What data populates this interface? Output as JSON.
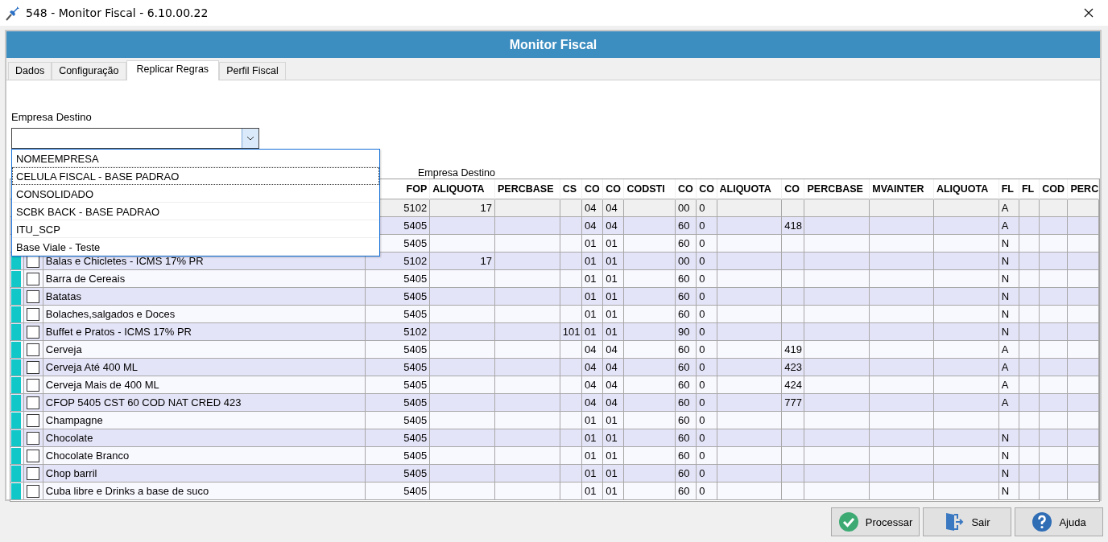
{
  "window": {
    "title": "548 - Monitor Fiscal - 6.10.00.22"
  },
  "header": {
    "title": "Monitor Fiscal"
  },
  "tabs": [
    {
      "label": "Dados",
      "selected": false
    },
    {
      "label": "Configuração",
      "selected": false
    },
    {
      "label": "Replicar Regras",
      "selected": true
    },
    {
      "label": "Perfil Fiscal",
      "selected": false
    }
  ],
  "empresa_destino": {
    "label": "Empresa Destino",
    "expanded": true,
    "options": [
      {
        "label": "NOMEEMPRESA",
        "focused": false
      },
      {
        "label": "CELULA FISCAL - BASE PADRAO",
        "focused": true
      },
      {
        "label": "CONSOLIDADO",
        "focused": false
      },
      {
        "label": "SCBK BACK - BASE PADRAO",
        "focused": false
      },
      {
        "label": "ITU_SCP",
        "focused": false
      },
      {
        "label": "Base Viale - Teste",
        "focused": false
      }
    ]
  },
  "grid": {
    "caption": "Empresa Destino",
    "columns": [
      "FOP",
      "ALIQUOTA",
      "PERCBASE",
      "CS",
      "CO",
      "CO",
      "CODSTI",
      "CO",
      "CO",
      "ALIQUOTA",
      "CO",
      "PERCBASE",
      "MVAINTER",
      "ALIQUOTA",
      "FL",
      "FL",
      "COD",
      "PERC"
    ],
    "rows": [
      {
        "selected": true,
        "cells": [
          "5102",
          "17",
          null,
          null,
          "04",
          "04",
          null,
          "00",
          "0",
          null,
          null,
          null,
          null,
          null,
          "A",
          null,
          null,
          null
        ]
      },
      {
        "selected": false,
        "cells": [
          "5405",
          null,
          null,
          null,
          "04",
          "04",
          null,
          "60",
          "0",
          null,
          "418",
          null,
          null,
          null,
          "A",
          null,
          null,
          null
        ]
      },
      {
        "selected": false,
        "cells": [
          "5405",
          null,
          null,
          null,
          "01",
          "01",
          null,
          "60",
          "0",
          null,
          null,
          null,
          null,
          null,
          "N",
          null,
          null,
          null
        ]
      },
      {
        "selected": false,
        "name": "Balas e Chicletes - ICMS 17% PR",
        "cells": [
          "5102",
          "17",
          null,
          null,
          "01",
          "01",
          null,
          "00",
          "0",
          null,
          null,
          null,
          null,
          null,
          "N",
          null,
          null,
          null
        ]
      },
      {
        "selected": false,
        "checked": false,
        "name": "Barra de Cereais",
        "cells": [
          "5405",
          null,
          null,
          null,
          "01",
          "01",
          null,
          "60",
          "0",
          null,
          null,
          null,
          null,
          null,
          "N",
          null,
          null,
          null
        ]
      },
      {
        "selected": false,
        "checked": false,
        "name": "Batatas",
        "cells": [
          "5405",
          null,
          null,
          null,
          "01",
          "01",
          null,
          "60",
          "0",
          null,
          null,
          null,
          null,
          null,
          "N",
          null,
          null,
          null
        ]
      },
      {
        "selected": false,
        "checked": false,
        "name": "Bolaches,salgados e Doces",
        "cells": [
          "5405",
          null,
          null,
          null,
          "01",
          "01",
          null,
          "60",
          "0",
          null,
          null,
          null,
          null,
          null,
          "N",
          null,
          null,
          null
        ]
      },
      {
        "selected": false,
        "checked": false,
        "name": "Buffet e Pratos - ICMS 17% PR",
        "cells": [
          "5102",
          null,
          null,
          "101",
          "01",
          "01",
          null,
          "90",
          "0",
          null,
          null,
          null,
          null,
          null,
          "N",
          null,
          null,
          null
        ]
      },
      {
        "selected": false,
        "checked": false,
        "name": "Cerveja",
        "cells": [
          "5405",
          null,
          null,
          null,
          "04",
          "04",
          null,
          "60",
          "0",
          null,
          "419",
          null,
          null,
          null,
          "A",
          null,
          null,
          null
        ]
      },
      {
        "selected": false,
        "checked": false,
        "name": "Cerveja Até 400 ML",
        "cells": [
          "5405",
          null,
          null,
          null,
          "04",
          "04",
          null,
          "60",
          "0",
          null,
          "423",
          null,
          null,
          null,
          "A",
          null,
          null,
          null
        ]
      },
      {
        "selected": false,
        "checked": false,
        "name": "Cerveja Mais de 400 ML",
        "cells": [
          "5405",
          null,
          null,
          null,
          "04",
          "04",
          null,
          "60",
          "0",
          null,
          "424",
          null,
          null,
          null,
          "A",
          null,
          null,
          null
        ]
      },
      {
        "selected": false,
        "checked": false,
        "name": "CFOP 5405 CST 60 COD NAT CRED 423",
        "cells": [
          "5405",
          null,
          null,
          null,
          "04",
          "04",
          null,
          "60",
          "0",
          null,
          "777",
          null,
          null,
          null,
          "A",
          null,
          null,
          null
        ]
      },
      {
        "selected": false,
        "checked": false,
        "name": "Champagne",
        "cells": [
          "5405",
          null,
          null,
          null,
          "01",
          "01",
          null,
          "60",
          "0",
          null,
          null,
          null,
          null,
          null,
          null,
          null,
          null,
          null
        ]
      },
      {
        "selected": false,
        "checked": false,
        "name": "Chocolate",
        "cells": [
          "5405",
          null,
          null,
          null,
          "01",
          "01",
          null,
          "60",
          "0",
          null,
          null,
          null,
          null,
          null,
          "N",
          null,
          null,
          null
        ]
      },
      {
        "selected": false,
        "checked": false,
        "name": "Chocolate Branco",
        "cells": [
          "5405",
          null,
          null,
          null,
          "01",
          "01",
          null,
          "60",
          "0",
          null,
          null,
          null,
          null,
          null,
          "N",
          null,
          null,
          null
        ]
      },
      {
        "selected": false,
        "checked": false,
        "name": "Chop barril",
        "cells": [
          "5405",
          null,
          null,
          null,
          "01",
          "01",
          null,
          "60",
          "0",
          null,
          null,
          null,
          null,
          null,
          "N",
          null,
          null,
          null
        ]
      },
      {
        "selected": false,
        "checked": false,
        "name": "Cuba libre e Drinks a base de suco",
        "cells": [
          "5405",
          null,
          null,
          null,
          "01",
          "01",
          null,
          "60",
          "0",
          null,
          null,
          null,
          null,
          null,
          "N",
          null,
          null,
          null
        ]
      }
    ]
  },
  "buttons": [
    {
      "label": "Processar"
    },
    {
      "label": "Sair"
    },
    {
      "label": "Ajuda"
    }
  ]
}
